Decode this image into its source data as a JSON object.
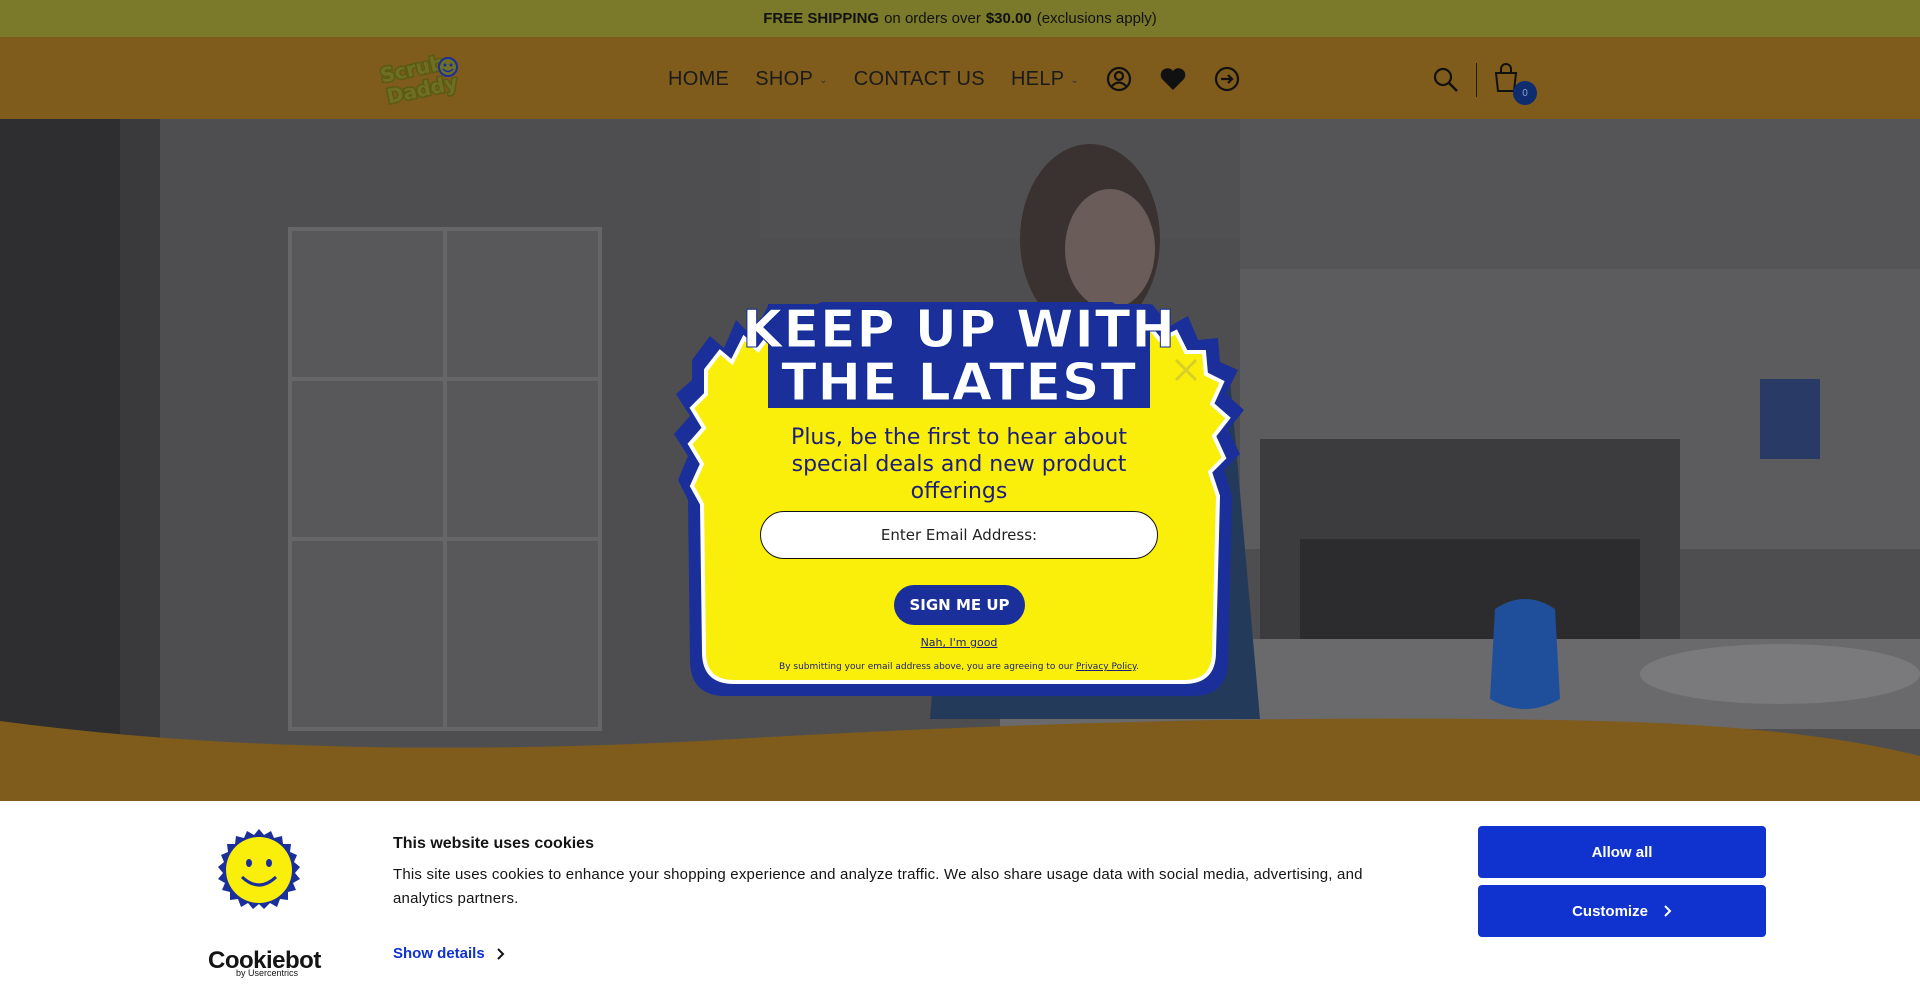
{
  "promo": {
    "bold1": "FREE SHIPPING",
    "text1": "on orders over",
    "bold2": "$30.00",
    "text2": "(exclusions apply)"
  },
  "header": {
    "logo_text": "Scrub Daddy",
    "nav": [
      {
        "label": "HOME",
        "has_caret": false
      },
      {
        "label": "SHOP",
        "has_caret": true
      },
      {
        "label": "CONTACT US",
        "has_caret": false
      },
      {
        "label": "HELP",
        "has_caret": true
      }
    ],
    "icons": [
      "account-icon",
      "heart-icon",
      "login-icon",
      "search-icon",
      "cart-icon"
    ],
    "cart_count": "0"
  },
  "popup": {
    "title_line1": "KEEP UP WITH",
    "title_line2": "THE LATEST",
    "subtitle": "Plus, be the first to hear about special deals and new product offerings",
    "email_placeholder": "Enter Email Address:",
    "signup_label": "SIGN ME UP",
    "decline_label": "Nah, I'm good",
    "disclaimer_text": "By submitting your email address above, you are agreeing to our",
    "privacy_link": "Privacy Policy",
    "disclaimer_end": "."
  },
  "cookie": {
    "brand": "Cookiebot",
    "brand_by": "by Usercentrics",
    "title": "This website uses cookies",
    "text": "This site uses cookies to enhance your shopping experience and analyze traffic. We also share usage data with social media, advertising, and analytics partners.",
    "details_label": "Show details",
    "allow_label": "Allow all",
    "customize_label": "Customize"
  },
  "colors": {
    "promo_bg": "#7a7a2a",
    "header_bg": "#7f5b1c",
    "popup_yellow": "#f9ef0b",
    "popup_blue": "#1a2f9a",
    "cookie_blue": "#1032cf"
  }
}
